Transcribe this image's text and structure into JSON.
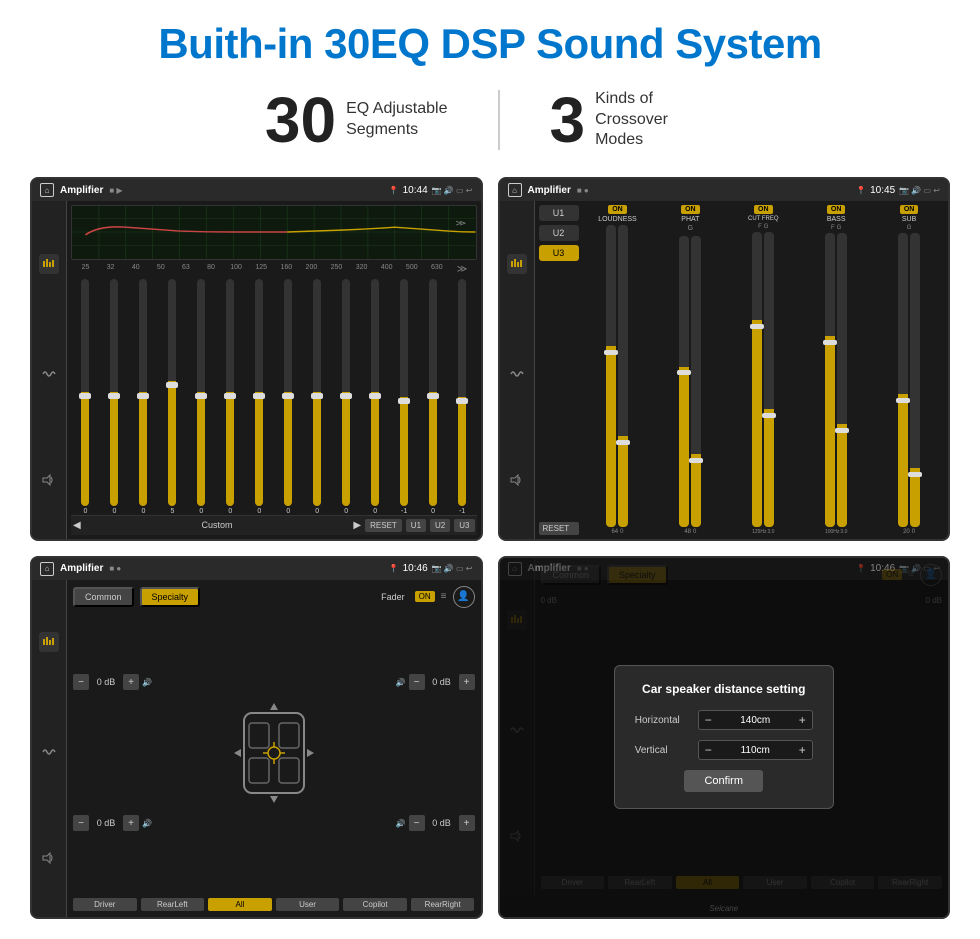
{
  "page": {
    "title": "Buith-in 30EQ DSP Sound System",
    "stat1_number": "30",
    "stat1_desc": "EQ Adjustable\nSegments",
    "stat2_number": "3",
    "stat2_desc": "Kinds of\nCrossover Modes"
  },
  "screen1": {
    "app_name": "Amplifier",
    "time": "10:44",
    "eq_bands": [
      "25",
      "32",
      "40",
      "50",
      "63",
      "80",
      "100",
      "125",
      "160",
      "200",
      "250",
      "320",
      "400",
      "500",
      "630"
    ],
    "eq_values": [
      "0",
      "0",
      "0",
      "0",
      "5",
      "0",
      "0",
      "0",
      "0",
      "0",
      "0",
      "0",
      "-1",
      "0",
      "-1"
    ],
    "preset": "Custom",
    "buttons": [
      "RESET",
      "U1",
      "U2",
      "U3"
    ]
  },
  "screen2": {
    "app_name": "Amplifier",
    "time": "10:45",
    "presets": [
      "U1",
      "U2",
      "U3"
    ],
    "active_preset": "U3",
    "channels": [
      "LOUDNESS",
      "PHAT",
      "CUT FREQ",
      "BASS",
      "SUB"
    ],
    "toggles": [
      "ON",
      "ON",
      "ON",
      "ON",
      "ON"
    ],
    "reset_label": "RESET"
  },
  "screen3": {
    "app_name": "Amplifier",
    "time": "10:46",
    "mode_common": "Common",
    "mode_specialty": "Specialty",
    "active_mode": "Specialty",
    "fader_label": "Fader",
    "fader_toggle": "ON",
    "db_values": [
      "0 dB",
      "0 dB",
      "0 dB",
      "0 dB"
    ],
    "zone_labels": [
      "Driver",
      "RearLeft",
      "All",
      "User",
      "Copilot",
      "RearRight"
    ]
  },
  "screen4": {
    "app_name": "Amplifier",
    "time": "10:46",
    "mode_common": "Common",
    "mode_specialty": "Specialty",
    "dialog": {
      "title": "Car speaker distance setting",
      "horizontal_label": "Horizontal",
      "horizontal_value": "140cm",
      "vertical_label": "Vertical",
      "vertical_value": "110cm",
      "confirm_label": "Confirm"
    },
    "db_values": [
      "0 dB",
      "0 dB"
    ],
    "zone_labels": [
      "Driver",
      "RearLeft",
      "All",
      "User",
      "Copilot",
      "RearRight"
    ],
    "watermark": "Seicane"
  },
  "icons": {
    "home": "⌂",
    "back": "↩",
    "settings": "⚙",
    "equalizer": "≋",
    "waveform": "∿",
    "volume": "♪",
    "location": "📍",
    "camera": "📷",
    "speaker": "🔊",
    "screen": "▭",
    "play": "▶",
    "pause": "⏸",
    "prev": "◀",
    "next": "▶▶",
    "minus": "−",
    "plus": "+"
  }
}
